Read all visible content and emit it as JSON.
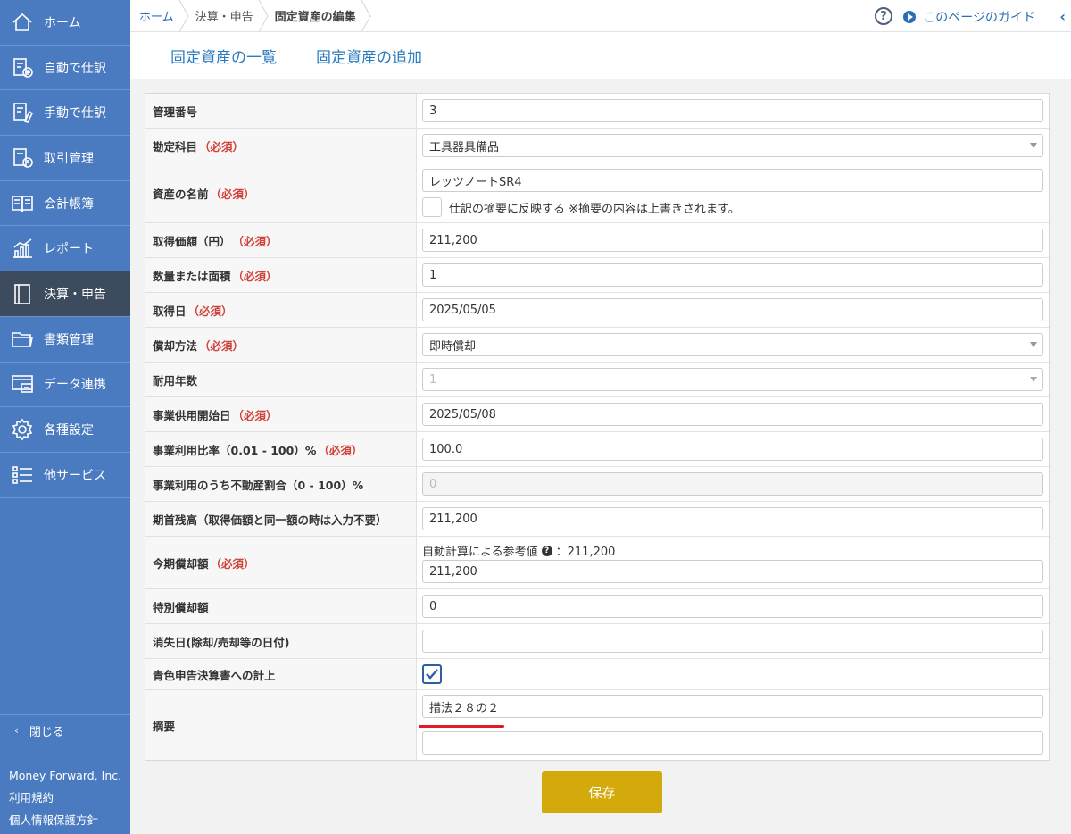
{
  "sidebar": {
    "items": [
      {
        "label": "ホーム",
        "icon": "home-icon"
      },
      {
        "label": "自動で仕訳",
        "icon": "auto-journal-icon"
      },
      {
        "label": "手動で仕訳",
        "icon": "manual-journal-icon"
      },
      {
        "label": "取引管理",
        "icon": "transaction-icon"
      },
      {
        "label": "会計帳簿",
        "icon": "book-icon"
      },
      {
        "label": "レポート",
        "icon": "report-icon"
      },
      {
        "label": "決算・申告",
        "icon": "settlement-icon"
      },
      {
        "label": "書類管理",
        "icon": "folder-icon"
      },
      {
        "label": "データ連携",
        "icon": "data-link-icon"
      },
      {
        "label": "各種設定",
        "icon": "gear-icon"
      },
      {
        "label": "他サービス",
        "icon": "list-icon"
      }
    ],
    "close_label": "閉じる",
    "footer": [
      "Money Forward, Inc.",
      "利用規約",
      "個人情報保護方針"
    ]
  },
  "breadcrumb": [
    "ホーム",
    "決算・申告",
    "固定資産の編集"
  ],
  "help_symbol": "?",
  "guide_label": "このページのガイド",
  "tabs": [
    "固定資産の一覧",
    "固定資産の追加"
  ],
  "form": {
    "required_label": "（必須）",
    "rows": {
      "kanri": {
        "label": "管理番号",
        "value": "3"
      },
      "kamoku": {
        "label": "勘定科目",
        "value": "工具器具備品"
      },
      "name": {
        "label": "資産の名前",
        "value": "レッツノートSR4",
        "checkbox_label": "仕訳の摘要に反映する ※摘要の内容は上書きされます。"
      },
      "price": {
        "label": "取得価額（円）",
        "value": "211,200"
      },
      "qty": {
        "label": "数量または面積",
        "value": "1"
      },
      "date": {
        "label": "取得日",
        "value": "2025/05/05"
      },
      "method": {
        "label": "償却方法",
        "value": "即時償却"
      },
      "years": {
        "label": "耐用年数",
        "value": "1"
      },
      "start": {
        "label": "事業供用開始日",
        "value": "2025/05/08"
      },
      "ratio": {
        "label": "事業利用比率（0.01 - 100）%",
        "value": "100.0"
      },
      "realestate": {
        "label": "事業利用のうち不動産割合（0 - 100）%",
        "value": "0"
      },
      "opening": {
        "label": "期首残高（取得価額と同一額の時は入力不要）",
        "value": "211,200"
      },
      "current": {
        "label": "今期償却額",
        "hint": "自動計算による参考値",
        "hint_value": "：211,200",
        "value": "211,200"
      },
      "special": {
        "label": "特別償却額",
        "value": "0"
      },
      "lost": {
        "label": "消失日(除却/売却等の日付)",
        "value": ""
      },
      "blue": {
        "label": "青色申告決算書への計上",
        "checked": true
      },
      "memo": {
        "label": "摘要",
        "value1": "措法２８の２",
        "value2": ""
      }
    }
  },
  "save_label": "保存",
  "colors": {
    "sidebar": "#4a7ac0",
    "active": "#3c4b5e",
    "save": "#d4a90c",
    "required": "#d0423a",
    "link": "#2a7bbf"
  }
}
